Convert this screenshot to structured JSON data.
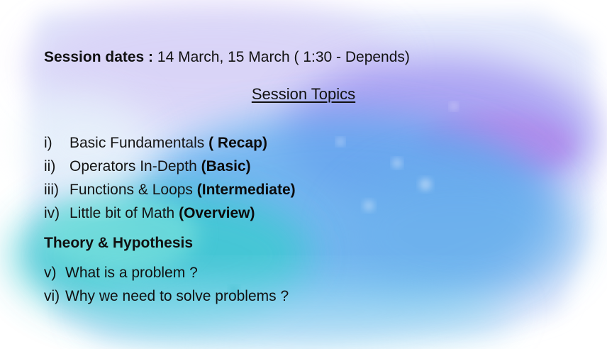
{
  "session": {
    "dates_label": "Session dates :",
    "dates_value": "14 March, 15 March ( 1:30 - Depends)"
  },
  "topics": {
    "heading": "Session Topics",
    "items": [
      {
        "num": "i)",
        "text": "Basic Fundamentals",
        "tag": "( Recap)"
      },
      {
        "num": "ii)",
        "text": "Operators In-Depth",
        "tag": "(Basic)"
      },
      {
        "num": "iii)",
        "text": "Functions & Loops",
        "tag": "(Intermediate)"
      },
      {
        "num": "iv)",
        "text": "Little bit of Math",
        "tag": "(Overview)"
      }
    ]
  },
  "theory": {
    "heading": "Theory & Hypothesis",
    "items": [
      {
        "num": "v)",
        "text": "What is a problem ?"
      },
      {
        "num": "vi)",
        "text": "Why we need to solve problems ?"
      }
    ]
  },
  "colors": {
    "background": "#ffffff",
    "wash_teal": "#5fd3d8",
    "wash_blue": "#5aa9ee",
    "wash_purple": "#9a8cf0",
    "wash_pale": "#c9d6f7",
    "text": "#111111"
  }
}
